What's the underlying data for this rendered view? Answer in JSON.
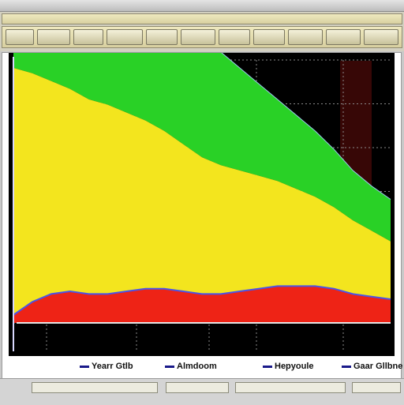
{
  "window": {
    "title": ""
  },
  "toolbar": {
    "buttons": [
      {
        "label": ""
      },
      {
        "label": ""
      },
      {
        "label": ""
      },
      {
        "label": ""
      },
      {
        "label": ""
      },
      {
        "label": ""
      },
      {
        "label": ""
      },
      {
        "label": ""
      },
      {
        "label": ""
      },
      {
        "label": ""
      },
      {
        "label": ""
      }
    ]
  },
  "colors": {
    "background": "#000000",
    "grid": "#8a8a8a",
    "green": "#29d126",
    "yellow": "#f3e51e",
    "red": "#ee2316",
    "outline": "#4a55e8",
    "highlight": "#4a0a08"
  },
  "chart_data": {
    "type": "area",
    "stacked": true,
    "grid": true,
    "legend": "bottom",
    "x": [
      0,
      1,
      2,
      3,
      4,
      5,
      6,
      7,
      8,
      9,
      10,
      11,
      12,
      13,
      14,
      15,
      16,
      17,
      18,
      19,
      20
    ],
    "ylim": [
      0,
      100
    ],
    "series": [
      {
        "name": "",
        "color": "#ee2316",
        "values": [
          3,
          8,
          11,
          12,
          11,
          11,
          12,
          13,
          13,
          12,
          11,
          11,
          12,
          13,
          14,
          14,
          14,
          13,
          11,
          10,
          9
        ]
      },
      {
        "name": "",
        "color": "#f3e51e",
        "values": [
          94,
          87,
          81,
          77,
          74,
          72,
          68,
          64,
          60,
          56,
          52,
          49,
          46,
          43,
          40,
          37,
          34,
          31,
          28,
          25,
          22
        ]
      },
      {
        "name": "",
        "color": "#29d126",
        "values": [
          94,
          91,
          87,
          82,
          77,
          72,
          67,
          62,
          57,
          52,
          48,
          43,
          39,
          35,
          31,
          28,
          25,
          22,
          19,
          17,
          16
        ]
      }
    ]
  },
  "legend": {
    "items": [
      {
        "label": "Yearr Gtlb",
        "color": "#1a1a8a"
      },
      {
        "label": "Almdoom",
        "color": "#1a1a8a"
      },
      {
        "label": "Hepyoule",
        "color": "#1a1a8a"
      },
      {
        "label": "Gaar Gllbne",
        "color": "#1a1a8a"
      }
    ]
  },
  "statusbar": {
    "fields": [
      {
        "text": ""
      },
      {
        "text": ""
      },
      {
        "text": ""
      },
      {
        "text": ""
      }
    ]
  }
}
